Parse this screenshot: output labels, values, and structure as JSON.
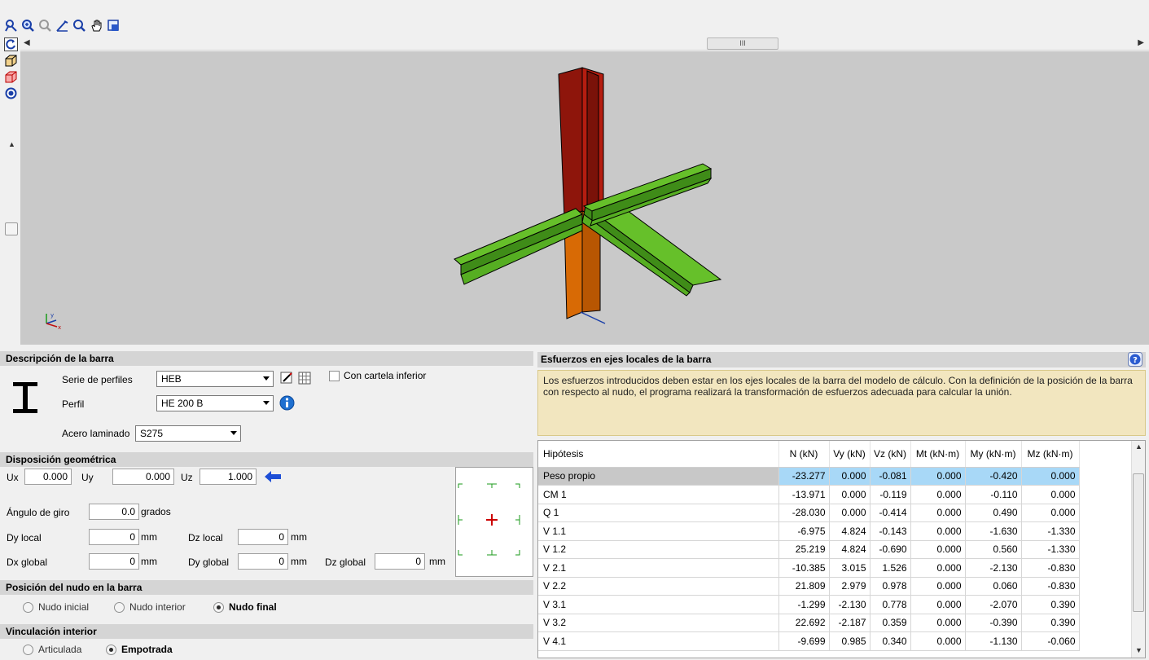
{
  "toolbar": {
    "icons": [
      "select-icon",
      "zoom-window-icon",
      "zoom-all-icon",
      "measure-icon",
      "zoom-icon",
      "pan-hand-icon",
      "screenshot-icon"
    ]
  },
  "view": {
    "left_icons": [
      "rotate-icon",
      "box-view-icon",
      "wireframe-view-icon",
      "render-options-icon"
    ],
    "hscroll_label": "III",
    "colors": {
      "background": "#c9c9c9",
      "column_upper": "#a81a0d",
      "column_lower": "#d96a06",
      "beams": "#5bb522"
    }
  },
  "descripcion": {
    "title": "Descripción de la barra",
    "serie_label": "Serie de perfiles",
    "serie_value": "HEB",
    "cartela_label": "Con cartela inferior",
    "perfil_label": "Perfil",
    "perfil_value": "HE 200 B",
    "acero_label": "Acero laminado",
    "acero_value": "S275"
  },
  "disposicion": {
    "title": "Disposición geométrica",
    "ux_label": "Ux",
    "ux_value": "0.000",
    "uy_label": "Uy",
    "uy_value": "0.000",
    "uz_label": "Uz",
    "uz_value": "1.000",
    "angulo_label": "Ángulo de giro",
    "angulo_value": "0.0",
    "angulo_unit": "grados",
    "dy_local_label": "Dy local",
    "dy_local_value": "0",
    "dy_local_unit": "mm",
    "dz_local_label": "Dz local",
    "dz_local_value": "0",
    "dz_local_unit": "mm",
    "dx_global_label": "Dx global",
    "dx_global_value": "0",
    "dx_global_unit": "mm",
    "dy_global_label": "Dy global",
    "dy_global_value": "0",
    "dy_global_unit": "mm",
    "dz_global_label": "Dz global",
    "dz_global_value": "0",
    "dz_global_unit": "mm"
  },
  "posicion": {
    "title": "Posición del nudo en la barra",
    "options": [
      "Nudo inicial",
      "Nudo interior",
      "Nudo final"
    ],
    "selected": "Nudo final"
  },
  "vinculacion": {
    "title": "Vinculación interior",
    "options": [
      "Articulada",
      "Empotrada"
    ],
    "selected": "Empotrada"
  },
  "esfuerzos": {
    "title": "Esfuerzos en ejes locales de la barra",
    "info": "Los esfuerzos introducidos deben estar en los ejes locales de la barra del modelo de cálculo. Con la definición de la posición de la barra con respecto al nudo, el programa realizará la transformación de esfuerzos adecuada para calcular la unión.",
    "columns": [
      "Hipótesis",
      "N (kN)",
      "Vy (kN)",
      "Vz (kN)",
      "Mt (kN·m)",
      "My (kN·m)",
      "Mz (kN·m)"
    ],
    "rows": [
      [
        "Peso propio",
        "-23.277",
        "0.000",
        "-0.081",
        "0.000",
        "-0.420",
        "0.000"
      ],
      [
        "CM 1",
        "-13.971",
        "0.000",
        "-0.119",
        "0.000",
        "-0.110",
        "0.000"
      ],
      [
        "Q 1",
        "-28.030",
        "0.000",
        "-0.414",
        "0.000",
        "0.490",
        "0.000"
      ],
      [
        "V 1.1",
        "-6.975",
        "4.824",
        "-0.143",
        "0.000",
        "-1.630",
        "-1.330"
      ],
      [
        "V 1.2",
        "25.219",
        "4.824",
        "-0.690",
        "0.000",
        "0.560",
        "-1.330"
      ],
      [
        "V 2.1",
        "-10.385",
        "3.015",
        "1.526",
        "0.000",
        "-2.130",
        "-0.830"
      ],
      [
        "V 2.2",
        "21.809",
        "2.979",
        "0.978",
        "0.000",
        "0.060",
        "-0.830"
      ],
      [
        "V 3.1",
        "-1.299",
        "-2.130",
        "0.778",
        "0.000",
        "-2.070",
        "0.390"
      ],
      [
        "V 3.2",
        "22.692",
        "-2.187",
        "0.359",
        "0.000",
        "-0.390",
        "0.390"
      ],
      [
        "V 4.1",
        "-9.699",
        "0.985",
        "0.340",
        "0.000",
        "-1.130",
        "-0.060"
      ]
    ],
    "selected_row": 0
  }
}
